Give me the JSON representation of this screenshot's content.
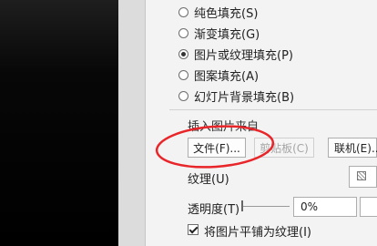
{
  "fill_options": [
    {
      "label": "纯色填充(S)",
      "checked": false
    },
    {
      "label": "渐变填充(G)",
      "checked": false
    },
    {
      "label": "图片或纹理填充(P)",
      "checked": true
    },
    {
      "label": "图案填充(A)",
      "checked": false
    },
    {
      "label": "幻灯片背景填充(B)",
      "checked": false
    }
  ],
  "insert_from": {
    "label": "插入图片来自",
    "file_button": "文件(F)...",
    "clipboard_button": "剪贴板(C)",
    "online_button": "联机(E)..."
  },
  "texture": {
    "label": "纹理(U)",
    "icon": "texture-swatch-icon"
  },
  "transparency": {
    "label": "透明度(T)",
    "value": "0%",
    "level": 0
  },
  "tile": {
    "label": "将图片平铺为纹理(I)",
    "checked": true
  },
  "annotation": {
    "color": "#e8262a",
    "shape": "ellipse"
  }
}
